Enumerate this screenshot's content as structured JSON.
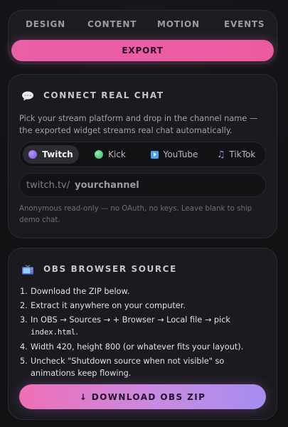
{
  "nav": {
    "tabs": [
      {
        "label": "DESIGN"
      },
      {
        "label": "CONTENT"
      },
      {
        "label": "MOTION"
      },
      {
        "label": "EVENTS"
      }
    ],
    "export_label": "EXPORT"
  },
  "chat": {
    "title": "CONNECT REAL CHAT",
    "icon": "speech-bubble-icon",
    "description": "Pick your stream platform and drop in the channel name — the exported widget streams real chat automatically.",
    "platforms": [
      {
        "label": "Twitch",
        "icon": "twitch-dot-icon",
        "color": "#9b6bf2",
        "selected": true
      },
      {
        "label": "Kick",
        "icon": "kick-dot-icon",
        "color": "#3ccf6e",
        "selected": false
      },
      {
        "label": "YouTube",
        "icon": "youtube-play-icon",
        "color": "#4aa4f0",
        "selected": false
      },
      {
        "label": "TikTok",
        "icon": "music-note-icon",
        "color": "#a989f0",
        "selected": false
      }
    ],
    "channel_prefix": "twitch.tv/",
    "channel_placeholder": "yourchannel",
    "channel_value": "",
    "hint": "Anonymous read-only — no OAuth, no keys. Leave blank to ship demo chat."
  },
  "obs": {
    "title": "OBS BROWSER SOURCE",
    "icon": "tv-icon",
    "steps": [
      {
        "num": "1.",
        "text": "Download the ZIP below."
      },
      {
        "num": "2.",
        "text": "Extract it anywhere on your computer."
      },
      {
        "num": "3.",
        "text": "In OBS → Sources → + Browser → Local file → pick",
        "code": "index.html",
        "after": "."
      },
      {
        "num": "4.",
        "text": "Width 420, height 800 (or whatever fits your layout)."
      },
      {
        "num": "5.",
        "text": "Uncheck \"Shutdown source when not visible\" so animations keep flowing."
      }
    ],
    "download_label": "↓ DOWNLOAD OBS ZIP"
  },
  "colors": {
    "accent_pink": "#ec5ba0",
    "accent_purple": "#a58df0",
    "card_bg": "#1a1a1f"
  }
}
